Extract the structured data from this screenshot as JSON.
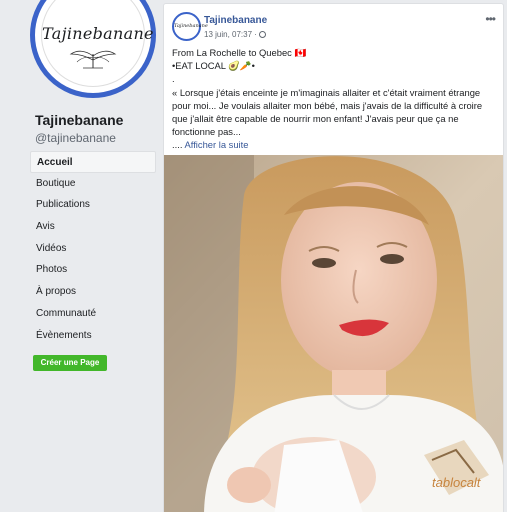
{
  "page": {
    "name": "Tajinebanane",
    "handle": "@tajinebanane",
    "logo_text": "Tajinebanane"
  },
  "sidebar": {
    "items": [
      {
        "label": "Accueil",
        "active": true
      },
      {
        "label": "Boutique"
      },
      {
        "label": "Publications"
      },
      {
        "label": "Avis"
      },
      {
        "label": "Vidéos"
      },
      {
        "label": "Photos"
      },
      {
        "label": "À propos"
      },
      {
        "label": "Communauté"
      },
      {
        "label": "Évènements"
      }
    ],
    "create_page": "Créer une Page"
  },
  "post": {
    "author": "Tajinebanane",
    "date": "13 juin, 07:37 ·",
    "lines": [
      "From La Rochelle to Quebec 🇨🇦",
      "•EAT LOCAL 🥑🥕•",
      ".",
      "« Lorsque j'étais enceinte je m'imaginais allaiter et c'était vraiment étrange pour moi... Je voulais allaiter mon bébé, mais j'avais de la difficulté à croire que j'allait être capable de nourrir mon enfant! J'avais peur que ça ne fonctionne pas..."
    ],
    "ellipsis": "....",
    "see_more": "Afficher la suite",
    "shirt_text": "tablocalt"
  },
  "colors": {
    "accent": "#385898",
    "avatar_ring": "#3b63c9",
    "create_button": "#42b72a",
    "background": "#e9ebee"
  }
}
